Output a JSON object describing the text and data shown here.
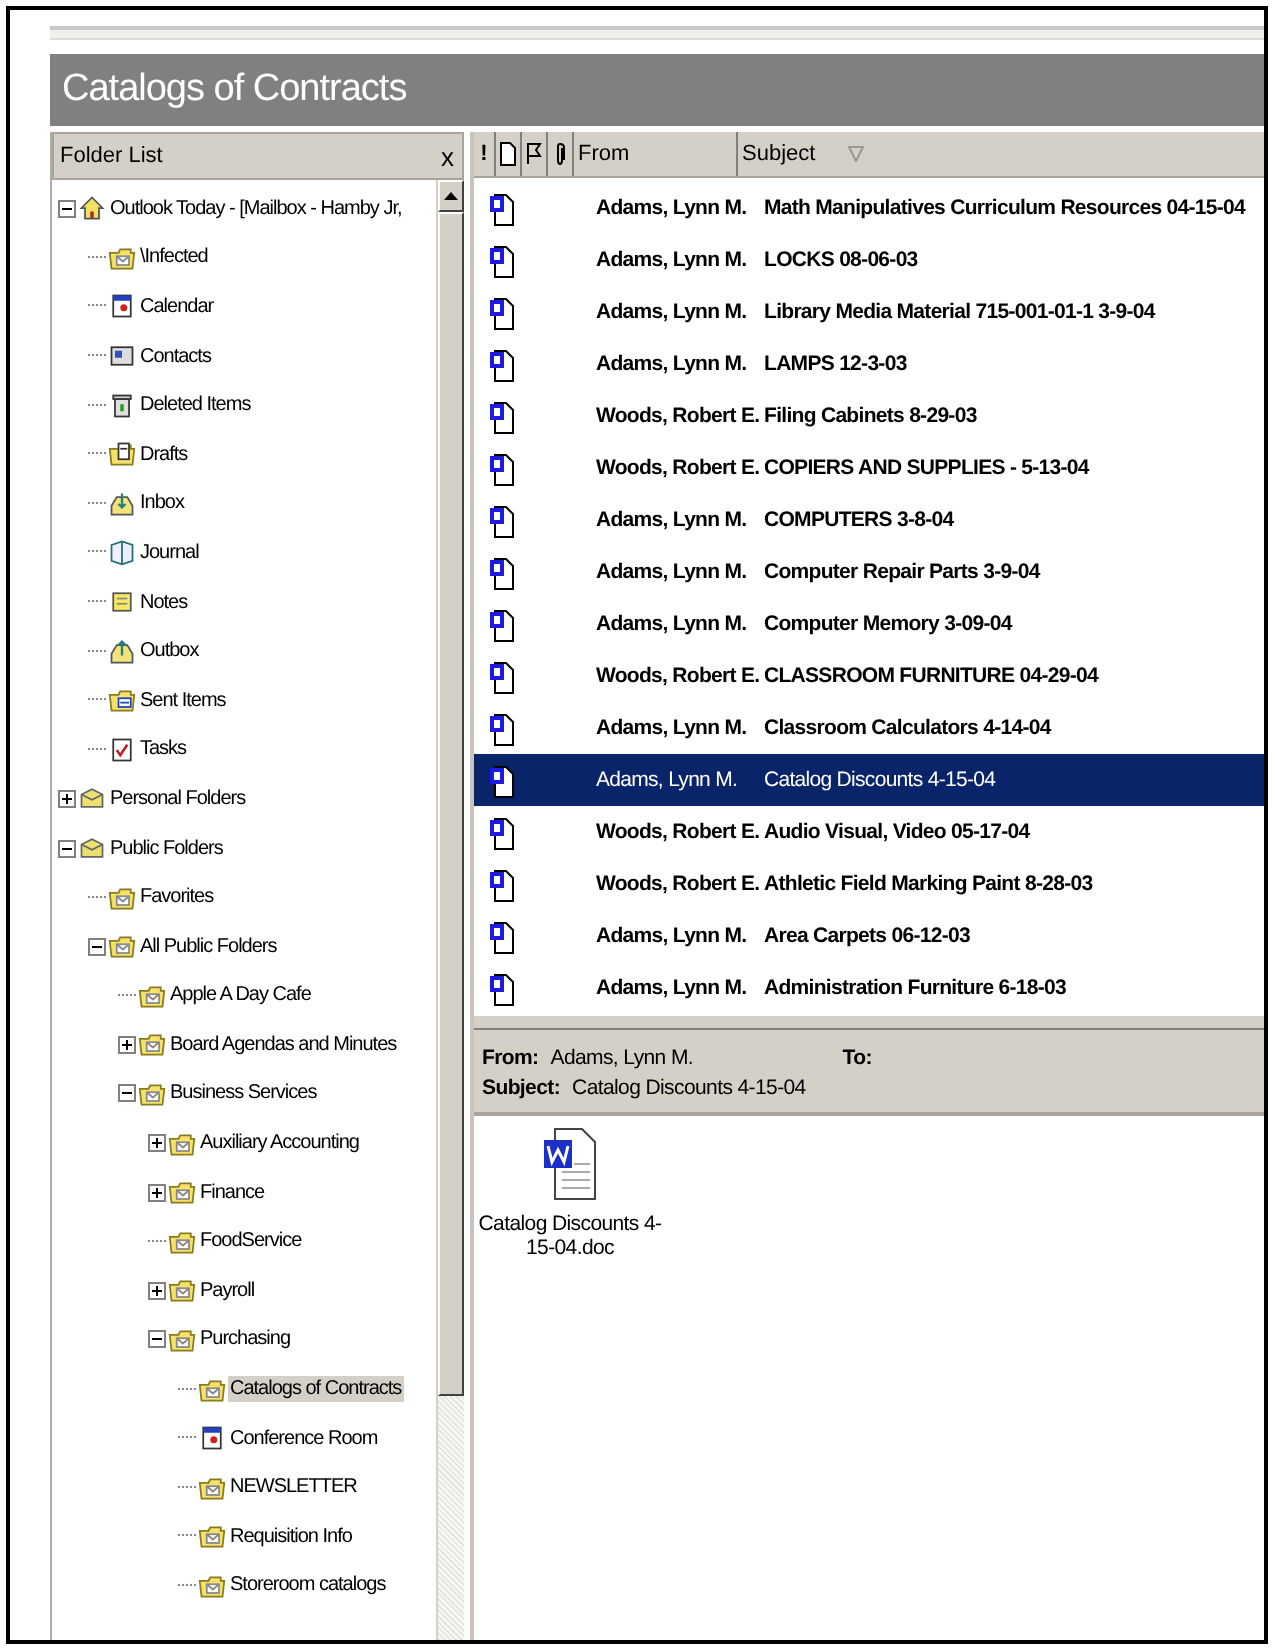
{
  "window": {
    "title": "Catalogs of Contracts"
  },
  "folder_pane": {
    "title": "Folder List",
    "close": "x",
    "tree": [
      {
        "label": "Outlook Today - [Mailbox - Hamby  Jr,",
        "kind": "home",
        "expanded": true,
        "selected": false,
        "children": [
          {
            "label": "\\Infected",
            "kind": "folder",
            "selected": false
          },
          {
            "label": "Calendar",
            "kind": "calendar",
            "selected": false
          },
          {
            "label": "Contacts",
            "kind": "contacts",
            "selected": false
          },
          {
            "label": "Deleted Items",
            "kind": "trash",
            "selected": false
          },
          {
            "label": "Drafts",
            "kind": "drafts",
            "selected": false
          },
          {
            "label": "Inbox",
            "kind": "inbox",
            "selected": false
          },
          {
            "label": "Journal",
            "kind": "journal",
            "selected": false
          },
          {
            "label": "Notes",
            "kind": "notes",
            "selected": false
          },
          {
            "label": "Outbox",
            "kind": "outbox",
            "selected": false
          },
          {
            "label": "Sent Items",
            "kind": "sent",
            "selected": false
          },
          {
            "label": "Tasks",
            "kind": "tasks",
            "selected": false
          }
        ]
      },
      {
        "label": "Personal Folders",
        "kind": "store",
        "expanded": false,
        "selected": false
      },
      {
        "label": "Public Folders",
        "kind": "store",
        "expanded": true,
        "selected": false,
        "children": [
          {
            "label": "Favorites",
            "kind": "folder",
            "selected": false
          },
          {
            "label": "All Public Folders",
            "kind": "folder",
            "expanded": true,
            "selected": false,
            "children": [
              {
                "label": "Apple A Day Cafe",
                "kind": "folder",
                "selected": false
              },
              {
                "label": "Board Agendas and Minutes",
                "kind": "folder",
                "expanded": false,
                "selected": false
              },
              {
                "label": "Business Services",
                "kind": "folder",
                "expanded": true,
                "selected": false,
                "children": [
                  {
                    "label": "Auxiliary Accounting",
                    "kind": "folder",
                    "expanded": false,
                    "selected": false
                  },
                  {
                    "label": "Finance",
                    "kind": "folder",
                    "expanded": false,
                    "selected": false
                  },
                  {
                    "label": "FoodService",
                    "kind": "folder",
                    "selected": false
                  },
                  {
                    "label": "Payroll",
                    "kind": "folder",
                    "expanded": false,
                    "selected": false
                  },
                  {
                    "label": "Purchasing",
                    "kind": "folder",
                    "expanded": true,
                    "selected": false,
                    "children": [
                      {
                        "label": "Catalogs of Contracts",
                        "kind": "folder",
                        "selected": true
                      },
                      {
                        "label": "Conference Room",
                        "kind": "calendar",
                        "selected": false
                      },
                      {
                        "label": "NEWSLETTER",
                        "kind": "folder",
                        "selected": false
                      },
                      {
                        "label": "Requisition Info",
                        "kind": "folder",
                        "selected": false
                      },
                      {
                        "label": "Storeroom catalogs",
                        "kind": "folder",
                        "selected": false
                      }
                    ]
                  }
                ]
              }
            ]
          }
        ]
      }
    ]
  },
  "message_list": {
    "columns": {
      "importance": "!",
      "from": "From",
      "subject": "Subject"
    },
    "rows": [
      {
        "from": "Adams, Lynn M.",
        "subject": "Math Manipulatives Curriculum Resources 04-15-04",
        "unread": true,
        "selected": false
      },
      {
        "from": "Adams, Lynn M.",
        "subject": "LOCKS  08-06-03",
        "unread": true,
        "selected": false
      },
      {
        "from": "Adams, Lynn M.",
        "subject": "Library Media Material 715-001-01-1  3-9-04",
        "unread": true,
        "selected": false
      },
      {
        "from": "Adams, Lynn M.",
        "subject": "LAMPS 12-3-03",
        "unread": true,
        "selected": false
      },
      {
        "from": "Woods, Robert E.",
        "subject": "Filing Cabinets  8-29-03",
        "unread": true,
        "selected": false
      },
      {
        "from": "Woods, Robert E.",
        "subject": "COPIERS AND SUPPLIES - 5-13-04",
        "unread": true,
        "selected": false
      },
      {
        "from": "Adams, Lynn M.",
        "subject": "COMPUTERS  3-8-04",
        "unread": true,
        "selected": false
      },
      {
        "from": "Adams, Lynn M.",
        "subject": "Computer Repair Parts 3-9-04",
        "unread": true,
        "selected": false
      },
      {
        "from": "Adams, Lynn M.",
        "subject": "Computer Memory 3-09-04",
        "unread": true,
        "selected": false
      },
      {
        "from": "Woods, Robert E.",
        "subject": "CLASSROOM FURNITURE 04-29-04",
        "unread": true,
        "selected": false
      },
      {
        "from": "Adams, Lynn M.",
        "subject": "Classroom Calculators 4-14-04",
        "unread": true,
        "selected": false
      },
      {
        "from": "Adams, Lynn M.",
        "subject": "Catalog Discounts 4-15-04",
        "unread": false,
        "selected": true
      },
      {
        "from": "Woods, Robert E.",
        "subject": "Audio Visual, Video 05-17-04",
        "unread": true,
        "selected": false
      },
      {
        "from": "Woods, Robert E.",
        "subject": "Athletic Field Marking Paint 8-28-03",
        "unread": true,
        "selected": false
      },
      {
        "from": "Adams, Lynn M.",
        "subject": "Area Carpets 06-12-03",
        "unread": true,
        "selected": false
      },
      {
        "from": "Adams, Lynn M.",
        "subject": "Administration Furniture 6-18-03",
        "unread": true,
        "selected": false
      }
    ]
  },
  "preview": {
    "from_label": "From:",
    "from": "Adams, Lynn M.",
    "to_label": "To:",
    "subject_label": "Subject:",
    "subject": "Catalog Discounts 4-15-04",
    "attachments": [
      {
        "name": "Catalog Discounts 4-15-04.doc"
      }
    ]
  }
}
